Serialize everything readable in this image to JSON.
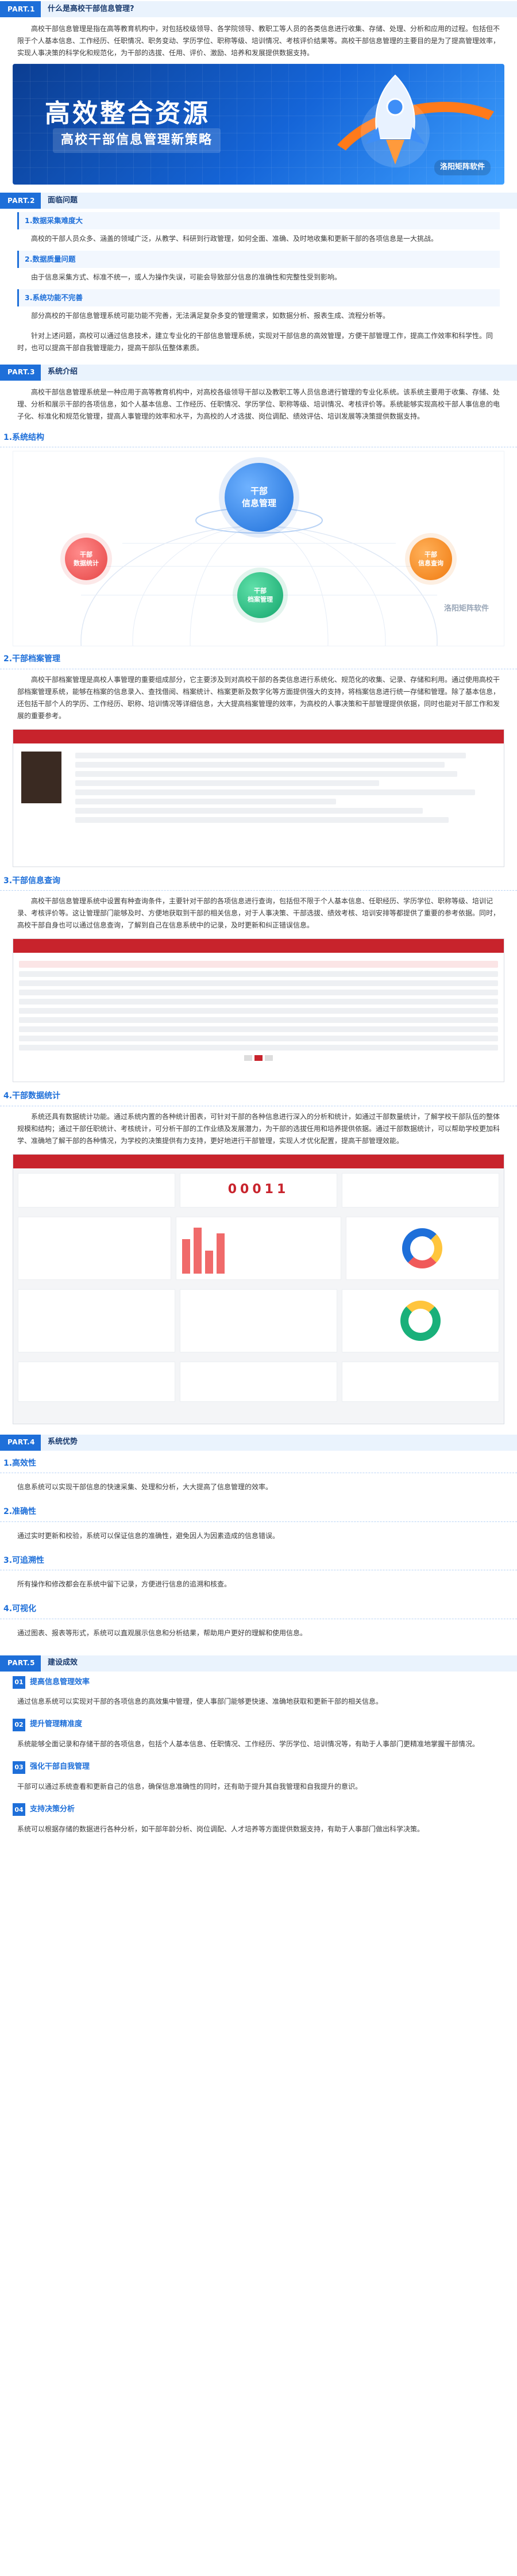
{
  "part1": {
    "tag": "PART.1",
    "title": "什么是高校干部信息管理?",
    "intro": "高校干部信息管理是指在高等教育机构中，对包括校级领导、各学院领导、教职工等人员的各类信息进行收集、存储、处理、分析和应用的过程。包括但不限于个人基本信息、工作经历、任职情况、职务变动、学历学位、职称等级、培训情况、考核评价结果等。高校干部信息管理的主要目的是为了提高管理效率，实现人事决策的科学化和规范化，为干部的选拔、任用、评价、激励、培养和发展提供数据支持。",
    "banner_title": "高效整合资源",
    "banner_sub": "高校干部信息管理新策略",
    "banner_brand": "洛阳矩阵软件"
  },
  "part2": {
    "tag": "PART.2",
    "title": "面临问题",
    "items": [
      {
        "head": "1.数据采集难度大",
        "text": "高校的干部人员众多、涵盖的领域广泛，从教学、科研到行政管理，如何全面、准确、及时地收集和更新干部的各项信息是一大挑战。"
      },
      {
        "head": "2.数据质量问题",
        "text": "由于信息采集方式、标准不统一，或人为操作失误，可能会导致部分信息的准确性和完整性受到影响。"
      },
      {
        "head": "3.系统功能不完善",
        "text": "部分高校的干部信息管理系统可能功能不完善，无法满足复杂多变的管理需求，如数据分析、报表生成、流程分析等。"
      }
    ],
    "summary": "针对上述问题，高校可以通过信息技术，建立专业化的干部信息管理系统，实现对干部信息的高效管理，方便干部管理工作，提高工作效率和科学性。同时，也可以提高干部自我管理能力，提高干部队伍整体素质。"
  },
  "part3": {
    "tag": "PART.3",
    "title": "系统介绍",
    "intro": "高校干部信息管理系统是一种应用于高等教育机构中，对高校各级领导干部以及教职工等人员信息进行管理的专业化系统。该系统主要用于收集、存储、处理、分析和展示干部的各项信息，如个人基本信息、工作经历、任职情况、学历学位、职称等级、培训情况、考核评价等。系统能够实现高校干部人事信息的电子化、标准化和规范化管理，提高人事管理的效率和水平，为高校的人才选拔、岗位调配、绩效评估、培训发展等决策提供数据支持。",
    "sections": [
      {
        "title": "1.系统结构",
        "diagram": {
          "center": "干部\n信息管理",
          "left": "干部\n数据统计",
          "bottom": "干部\n档案管理",
          "right": "干部\n信息查询",
          "brand": "洛阳矩阵软件"
        }
      },
      {
        "title": "2.干部档案管理",
        "text": "高校干部档案管理是高校人事管理的重要组成部分，它主要涉及到对高校干部的各类信息进行系统化、规范化的收集、记录、存储和利用。通过使用高校干部档案管理系统，能够在档案的信息录入、查找借阅、档案统计、档案更新及数字化等方面提供强大的支持，将档案信息进行统一存储和管理。除了基本信息，还包括干部个人的学历、工作经历、职称、培训情况等详细信息，大大提高档案管理的效率，为高校的人事决策和干部管理提供依据，同时也能对干部工作和发展的重要参考。"
      },
      {
        "title": "3.干部信息查询",
        "text": "高校干部信息管理系统中设置有种查询条件，主要针对干部的各项信息进行查询，包括但不限于个人基本信息、任职经历、学历学位、职称等级、培训记录、考核评价等。这让管理部门能够及时、方便地获取到干部的相关信息，对于人事决策、干部选拔、绩效考核、培训安排等都提供了重要的参考依据。同时，高校干部自身也可以通过信息查询，了解到自己在信息系统中的记录，及时更新和纠正错误信息。"
      },
      {
        "title": "4.干部数据统计",
        "text": "系统还具有数据统计功能。通过系统内置的各种统计图表，可针对干部的各种信息进行深入的分析和统计，如通过干部数量统计，了解学校干部队伍的整体规模和结构；通过干部任职统计、考核统计，可分析干部的工作业绩及发展潜力，为干部的选拔任用和培养提供依据。通过干部数据统计，可以帮助学校更加科学、准确地了解干部的各种情况，为学校的决策提供有力支持，更好地进行干部管理，实现人才优化配置，提高干部管理效能。",
        "dash_number": "00011"
      }
    ]
  },
  "part4": {
    "tag": "PART.4",
    "title": "系统优势",
    "items": [
      {
        "head": "1.高效性",
        "text": "信息系统可以实现干部信息的快速采集、处理和分析，大大提高了信息管理的效率。"
      },
      {
        "head": "2.准确性",
        "text": "通过实时更新和校验，系统可以保证信息的准确性，避免因人为因素造成的信息错误。"
      },
      {
        "head": "3.可追溯性",
        "text": "所有操作和修改都会在系统中留下记录，方便进行信息的追溯和核查。"
      },
      {
        "head": "4.可视化",
        "text": "通过图表、报表等形式，系统可以直观展示信息和分析结果，帮助用户更好的理解和使用信息。"
      }
    ]
  },
  "part5": {
    "tag": "PART.5",
    "title": "建设成效",
    "items": [
      {
        "num": "01",
        "head": "提高信息管理效率",
        "text": "通过信息系统可以实现对干部的各项信息的高效集中管理，使人事部门能够更快速、准确地获取和更新干部的相关信息。"
      },
      {
        "num": "02",
        "head": "提升管理精准度",
        "text": "系统能够全面记录和存储干部的各项信息，包括个人基本信息、任职情况、工作经历、学历学位、培训情况等，有助于人事部门更精准地掌握干部情况。"
      },
      {
        "num": "03",
        "head": "强化干部自我管理",
        "text": "干部可以通过系统查看和更新自己的信息，确保信息准确性的同时，还有助于提升其自我管理和自我提升的意识。"
      },
      {
        "num": "04",
        "head": "支持决策分析",
        "text": "系统可以根据存储的数据进行各种分析，如干部年龄分析、岗位调配、人才培养等方面提供数据支持，有助于人事部门做出科学决策。"
      }
    ]
  },
  "colors": {
    "primary": "#1e6fd9",
    "accent": "#ff7a1a",
    "banner_dark": "#0b3d91",
    "screenshot_header": "#c8232c",
    "green": "#19b07a",
    "pink": "#f05a5a"
  }
}
